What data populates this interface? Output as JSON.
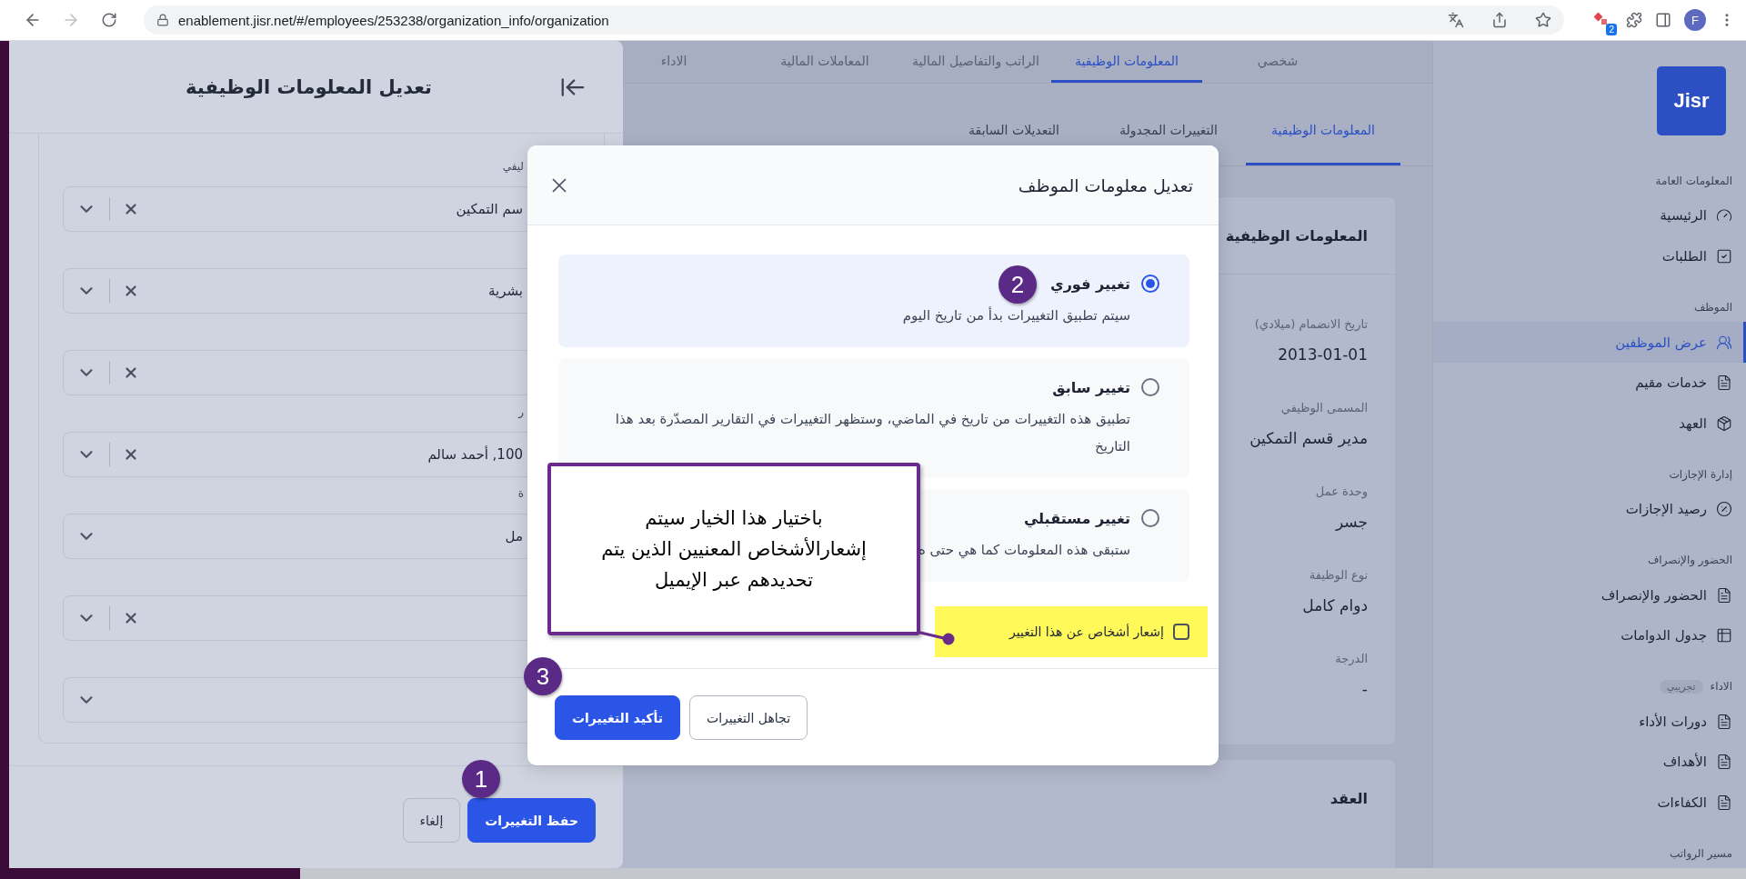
{
  "browser": {
    "url": "enablement.jisr.net/#/employees/253238/organization_info/organization",
    "extension_badge": "2",
    "profile_initial": "F"
  },
  "sidebar": {
    "logo": "Jisr",
    "sections": [
      {
        "title": "المعلومات العامة",
        "items": [
          {
            "label": "الرئيسية",
            "selected": false
          },
          {
            "label": "الطلبات",
            "selected": false
          }
        ]
      },
      {
        "title": "الموظف",
        "items": [
          {
            "label": "عرض الموظفين",
            "selected": true
          },
          {
            "label": "خدمات مقيم",
            "selected": false
          },
          {
            "label": "العهد",
            "selected": false
          }
        ]
      },
      {
        "title": "إدارة الإجازات",
        "items": [
          {
            "label": "رصيد الإجازات",
            "selected": false
          }
        ]
      },
      {
        "title": "الحضور والإنصراف",
        "items": [
          {
            "label": "الحضور والإنصراف",
            "selected": false
          },
          {
            "label": "جدول الدوامات",
            "selected": false
          }
        ]
      },
      {
        "title": "الاداء",
        "badge": "تجريبي",
        "items": [
          {
            "label": "دورات الأداء",
            "selected": false
          },
          {
            "label": "الأهداف",
            "selected": false
          },
          {
            "label": "الكفاءات",
            "selected": false
          }
        ]
      },
      {
        "title": "مسير الرواتب"
      }
    ]
  },
  "main": {
    "tabs": [
      {
        "label": "شخصي",
        "selected": false
      },
      {
        "label": "المعلومات الوظيفية",
        "selected": true
      },
      {
        "label": "الراتب والتفاصيل المالية",
        "selected": false
      },
      {
        "label": "المعاملات المالية",
        "selected": false
      },
      {
        "label": "الاداء",
        "selected": false
      }
    ],
    "subtabs": [
      {
        "label": "المعلومات الوظيفية",
        "selected": true
      },
      {
        "label": "التغييرات المجدولة",
        "selected": false
      },
      {
        "label": "التعديلات السابقة",
        "selected": false
      }
    ],
    "job_card": {
      "title": "المعلومات الوظيفية",
      "fields": [
        {
          "label": "تاريخ الانضمام (ميلادي)",
          "value": "2013-01-01"
        },
        {
          "label": "المسمى الوظيفي",
          "value": "مدير قسم التمكين"
        },
        {
          "label": "وحدة عمل",
          "value": "جسر"
        },
        {
          "label": "نوع الوظيفة",
          "value": "دوام كامل"
        },
        {
          "label": "الدرجة",
          "value": "-"
        }
      ]
    },
    "contract_card": {
      "title": "العقد"
    }
  },
  "drawer": {
    "title": "تعديل المعلومات الوظيفية",
    "fields": [
      {
        "label": "ليفي",
        "value": "سم التمكين",
        "clearable": true
      },
      {
        "value": "بشرية",
        "clearable": true
      },
      {
        "clearable": true
      },
      {
        "label": "ر",
        "value": "100, أحمد سالم",
        "clearable": true
      },
      {
        "label": "ة",
        "value": "مل",
        "clearable": false
      },
      {
        "clearable": true
      },
      {
        "clearable": false
      }
    ],
    "buttons": [
      {
        "label": "حفظ التغييرات",
        "kind": "primary"
      },
      {
        "label": "إلغاء",
        "kind": "secondary"
      }
    ]
  },
  "modal": {
    "title": "تعديل معلومات الموظف",
    "options": [
      {
        "title": "تغيير فوري",
        "description": "سيتم تطبيق التغييرات بدأ من تاريخ اليوم",
        "selected": true
      },
      {
        "title": "تغيير سابق",
        "description": "تطبيق هذه التغييرات من تاريخ في الماضي، وستظهر التغييرات في التقارير المصدّرة بعد هذا التاريخ",
        "selected": false
      },
      {
        "title": "تغيير مستقبلي",
        "description": "ستبقى هذه المعلومات كما هي حتى ه",
        "selected": false
      }
    ],
    "notify": {
      "label": "إشعار أشخاص عن هذا التغيير",
      "checked": false
    },
    "buttons": [
      {
        "label": "تجاهل التغييرات",
        "kind": "secondary"
      },
      {
        "label": "تأكيد التغييرات",
        "kind": "primary"
      }
    ]
  },
  "callout": {
    "text": "باختيار هذا الخيار سيتم\nإشعارالأشخاص المعنيين الذين يتم\nتحديدهم عبر الإيميل"
  },
  "steps": [
    "1",
    "2",
    "3"
  ]
}
